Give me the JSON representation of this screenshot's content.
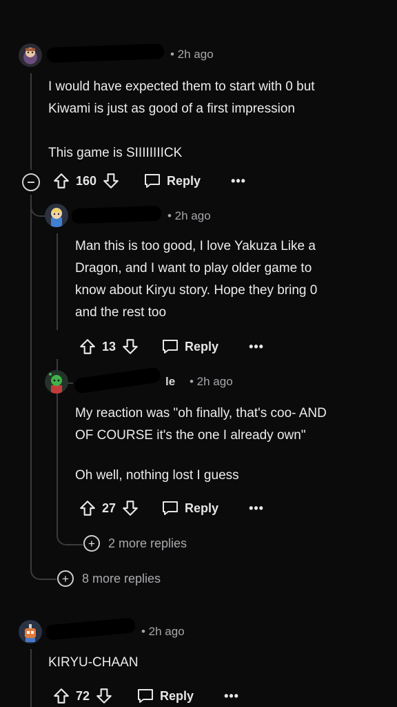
{
  "comments": [
    {
      "time": "• 2h ago",
      "lines": [
        "I would have expected them to start with 0 but",
        "Kiwami is just as good of a first impression",
        "",
        "This game is SIIIIIIIICK"
      ],
      "votes": "160",
      "reply_label": "Reply",
      "more_label": "•••"
    },
    {
      "time": "• 2h ago",
      "lines": [
        "Man this is too good, I love Yakuza Like a",
        "Dragon, and I want to play older game to",
        "know about Kiryu story. Hope they bring 0",
        "and the rest too"
      ],
      "votes": "13",
      "reply_label": "Reply",
      "more_label": "•••"
    },
    {
      "time": "• 2h ago",
      "name_fragment": "le",
      "lines": [
        "My reaction was \"oh finally, that's coo- AND",
        "OF COURSE it's the one I already own\"",
        "",
        "Oh well, nothing lost I guess"
      ],
      "votes": "27",
      "reply_label": "Reply",
      "more_label": "•••"
    },
    {
      "time": "• 2h ago",
      "lines": [
        "KIRYU-CHAAN"
      ],
      "votes": "72",
      "reply_label": "Reply",
      "more_label": "•••"
    }
  ],
  "more_replies": {
    "nested": "2 more replies",
    "top": "8 more replies"
  },
  "icons": {
    "upvote": "upvote-arrow-icon",
    "downvote": "downvote-arrow-icon",
    "reply": "speech-bubble-icon",
    "collapse": "collapse-minus-icon",
    "expand": "expand-plus-icon"
  },
  "colors": {
    "background": "#0b0b0c",
    "text": "#ececed",
    "meta": "#a6a7aa",
    "thread_line": "#3a3b3d"
  }
}
